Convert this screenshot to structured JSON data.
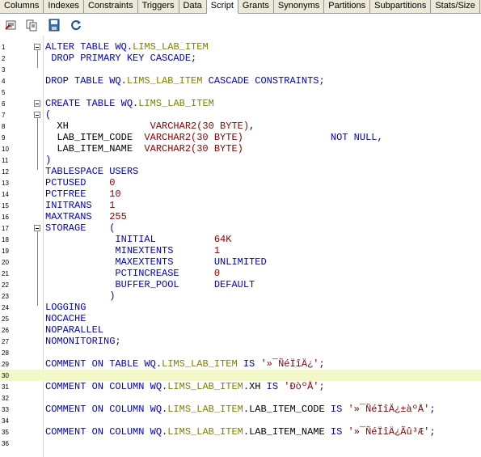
{
  "tabs": [
    {
      "label": "Columns"
    },
    {
      "label": "Indexes"
    },
    {
      "label": "Constraints"
    },
    {
      "label": "Triggers"
    },
    {
      "label": "Data"
    },
    {
      "label": "Script",
      "active": true
    },
    {
      "label": "Grants"
    },
    {
      "label": "Synonyms"
    },
    {
      "label": "Partitions"
    },
    {
      "label": "Subpartitions"
    },
    {
      "label": "Stats/Size"
    }
  ],
  "toolbar": [
    {
      "icon": "compile-icon"
    },
    {
      "icon": "copy-icon"
    },
    {
      "icon": "save-icon"
    },
    {
      "icon": "refresh-icon"
    }
  ],
  "lines": [
    {
      "n": "1",
      "t": [
        [
          "kw",
          "ALTER TABLE "
        ],
        [
          "kw",
          "WQ."
        ],
        [
          "id",
          "LIMS_LAB_ITEM"
        ]
      ]
    },
    {
      "n": "2",
      "t": [
        [
          "kw",
          " DROP PRIMARY KEY CASCADE;"
        ]
      ]
    },
    {
      "n": "3",
      "t": []
    },
    {
      "n": "4",
      "t": [
        [
          "kw",
          "DROP TABLE "
        ],
        [
          "kw",
          "WQ."
        ],
        [
          "id",
          "LIMS_LAB_ITEM"
        ],
        [
          "kw",
          " CASCADE CONSTRAINTS;"
        ]
      ]
    },
    {
      "n": "5",
      "t": []
    },
    {
      "n": "6",
      "t": [
        [
          "kw",
          "CREATE TABLE "
        ],
        [
          "kw",
          "WQ."
        ],
        [
          "id",
          "LIMS_LAB_ITEM"
        ]
      ]
    },
    {
      "n": "7",
      "t": [
        [
          "kw",
          "("
        ]
      ]
    },
    {
      "n": "8",
      "t": [
        [
          "plain",
          "  XH              "
        ],
        [
          "ty",
          "VARCHAR2(30 BYTE)"
        ],
        [
          "kw",
          ","
        ]
      ]
    },
    {
      "n": "9",
      "t": [
        [
          "plain",
          "  LAB_ITEM_CODE  "
        ],
        [
          "ty",
          "VARCHAR2(30 BYTE)"
        ],
        [
          "plain",
          "               "
        ],
        [
          "kw",
          "NOT NULL,"
        ]
      ]
    },
    {
      "n": "10",
      "t": [
        [
          "plain",
          "  LAB_ITEM_NAME  "
        ],
        [
          "ty",
          "VARCHAR2(30 BYTE)"
        ]
      ]
    },
    {
      "n": "11",
      "t": [
        [
          "kw",
          ")"
        ]
      ]
    },
    {
      "n": "12",
      "t": [
        [
          "kw",
          "TABLESPACE USERS"
        ]
      ]
    },
    {
      "n": "13",
      "t": [
        [
          "kw",
          "PCTUSED    "
        ],
        [
          "num",
          "0"
        ]
      ]
    },
    {
      "n": "14",
      "t": [
        [
          "kw",
          "PCTFREE    "
        ],
        [
          "num",
          "10"
        ]
      ]
    },
    {
      "n": "15",
      "t": [
        [
          "kw",
          "INITRANS   "
        ],
        [
          "num",
          "1"
        ]
      ]
    },
    {
      "n": "16",
      "t": [
        [
          "kw",
          "MAXTRANS   "
        ],
        [
          "num",
          "255"
        ]
      ]
    },
    {
      "n": "17",
      "t": [
        [
          "kw",
          "STORAGE    ("
        ]
      ]
    },
    {
      "n": "18",
      "t": [
        [
          "kw",
          "            INITIAL          "
        ],
        [
          "num",
          "64K"
        ]
      ]
    },
    {
      "n": "19",
      "t": [
        [
          "kw",
          "            MINEXTENTS       "
        ],
        [
          "num",
          "1"
        ]
      ]
    },
    {
      "n": "20",
      "t": [
        [
          "kw",
          "            MAXEXTENTS       UNLIMITED"
        ]
      ]
    },
    {
      "n": "21",
      "t": [
        [
          "kw",
          "            PCTINCREASE      "
        ],
        [
          "num",
          "0"
        ]
      ]
    },
    {
      "n": "22",
      "t": [
        [
          "kw",
          "            BUFFER_POOL      DEFAULT"
        ]
      ]
    },
    {
      "n": "23",
      "t": [
        [
          "kw",
          "           )"
        ]
      ]
    },
    {
      "n": "24",
      "t": [
        [
          "kw",
          "LOGGING"
        ]
      ]
    },
    {
      "n": "25",
      "t": [
        [
          "kw",
          "NOCACHE"
        ]
      ]
    },
    {
      "n": "26",
      "t": [
        [
          "kw",
          "NOPARALLEL"
        ]
      ]
    },
    {
      "n": "27",
      "t": [
        [
          "kw",
          "NOMONITORING;"
        ]
      ]
    },
    {
      "n": "28",
      "t": []
    },
    {
      "n": "29",
      "t": [
        [
          "kw",
          "COMMENT ON TABLE "
        ],
        [
          "kw",
          "WQ."
        ],
        [
          "id",
          "LIMS_LAB_ITEM"
        ],
        [
          "kw",
          " IS "
        ],
        [
          "str",
          "'»¯ÑéÏîÄ¿'"
        ],
        [
          "kw",
          ";"
        ]
      ]
    },
    {
      "n": "30",
      "t": [],
      "hl": true
    },
    {
      "n": "31",
      "t": [
        [
          "kw",
          "COMMENT ON COLUMN "
        ],
        [
          "kw",
          "WQ."
        ],
        [
          "id",
          "LIMS_LAB_ITEM"
        ],
        [
          "kw",
          "."
        ],
        [
          "plain",
          "XH"
        ],
        [
          "kw",
          " IS "
        ],
        [
          "str",
          "'ĐòºÅ'"
        ],
        [
          "kw",
          ";"
        ]
      ]
    },
    {
      "n": "32",
      "t": []
    },
    {
      "n": "33",
      "t": [
        [
          "kw",
          "COMMENT ON COLUMN "
        ],
        [
          "kw",
          "WQ."
        ],
        [
          "id",
          "LIMS_LAB_ITEM"
        ],
        [
          "kw",
          "."
        ],
        [
          "plain",
          "LAB_ITEM_CODE"
        ],
        [
          "kw",
          " IS "
        ],
        [
          "str",
          "'»¯ÑéÏîÄ¿±àºÅ'"
        ],
        [
          "kw",
          ";"
        ]
      ]
    },
    {
      "n": "34",
      "t": []
    },
    {
      "n": "35",
      "t": [
        [
          "kw",
          "COMMENT ON COLUMN "
        ],
        [
          "kw",
          "WQ."
        ],
        [
          "id",
          "LIMS_LAB_ITEM"
        ],
        [
          "kw",
          "."
        ],
        [
          "plain",
          "LAB_ITEM_NAME"
        ],
        [
          "kw",
          " IS "
        ],
        [
          "str",
          "'»¯ÑéÏîÄ¿Ãû³Æ'"
        ],
        [
          "kw",
          ";"
        ]
      ]
    },
    {
      "n": "36",
      "t": []
    }
  ]
}
